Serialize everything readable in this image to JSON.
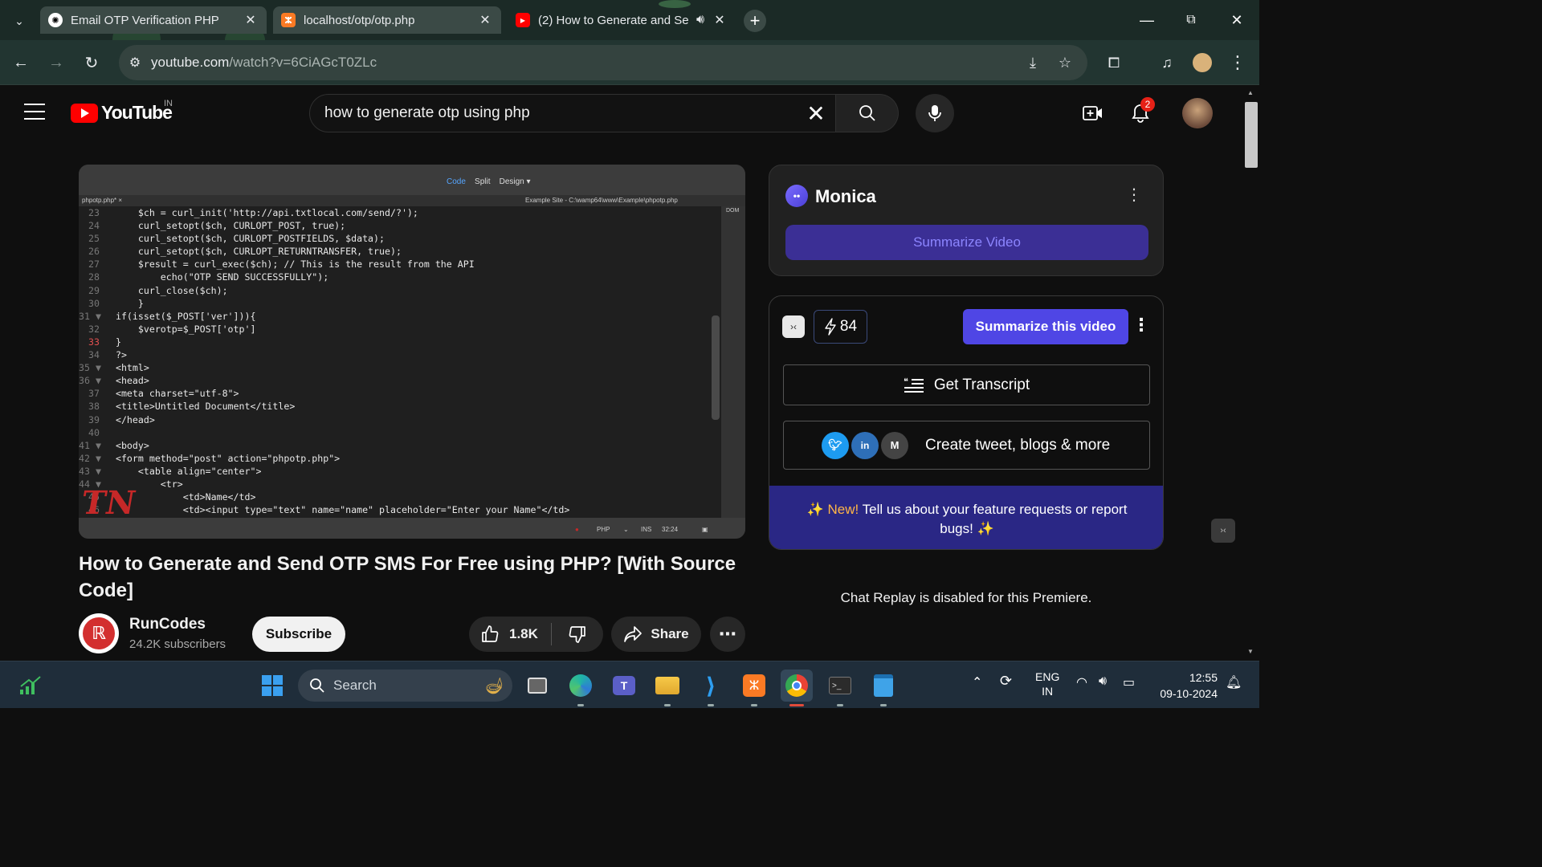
{
  "browser": {
    "tabs": [
      {
        "title": "Email OTP Verification PHP",
        "icon": "chatgpt-icon"
      },
      {
        "title": "localhost/otp/otp.php",
        "icon": "xampp-icon"
      },
      {
        "title": "(2) How to Generate and Se",
        "icon": "youtube-icon"
      }
    ],
    "url_host": "youtube.com",
    "url_path": "/watch?v=6CiAGcT0ZLc"
  },
  "youtube": {
    "logo_text": "YouTube",
    "country": "IN",
    "search_query": "how to generate otp using php",
    "notification_count": "2"
  },
  "editor": {
    "modes": [
      "Code",
      "Split",
      "Design"
    ],
    "file_tab": "phpotp.php* ×",
    "path": "Example Site - C:\\wamp64\\www\\Example\\phpotp.php",
    "side_label": "DOM",
    "status": {
      "lang": "PHP",
      "mode": "INS",
      "pos": "32:24"
    },
    "lines": [
      {
        "n": "23",
        "t": "      $ch = curl_init('http://api.txtlocal.com/send/?');"
      },
      {
        "n": "24",
        "t": "      curl_setopt($ch, CURLOPT_POST, true);"
      },
      {
        "n": "25",
        "t": "      curl_setopt($ch, CURLOPT_POSTFIELDS, $data);"
      },
      {
        "n": "26",
        "t": "      curl_setopt($ch, CURLOPT_RETURNTRANSFER, true);"
      },
      {
        "n": "27",
        "t": "      $result = curl_exec($ch); // This is the result from the API"
      },
      {
        "n": "28",
        "t": "          echo(\"OTP SEND SUCCESSFULLY\");"
      },
      {
        "n": "29",
        "t": "      curl_close($ch);"
      },
      {
        "n": "30",
        "t": "      }"
      },
      {
        "n": "31 ▼",
        "t": "  if(isset($_POST['ver'])){"
      },
      {
        "n": "32",
        "t": "      $verotp=$_POST['otp']"
      },
      {
        "n": "33",
        "t": "  }"
      },
      {
        "n": "34",
        "t": "  ?>"
      },
      {
        "n": "35 ▼",
        "t": "  <html>"
      },
      {
        "n": "36 ▼",
        "t": "  <head>"
      },
      {
        "n": "37",
        "t": "  <meta charset=\"utf-8\">"
      },
      {
        "n": "38",
        "t": "  <title>Untitled Document</title>"
      },
      {
        "n": "39",
        "t": "  </head>"
      },
      {
        "n": "40",
        "t": ""
      },
      {
        "n": "41 ▼",
        "t": "  <body>"
      },
      {
        "n": "42 ▼",
        "t": "  <form method=\"post\" action=\"phpotp.php\">"
      },
      {
        "n": "43 ▼",
        "t": "      <table align=\"center\">"
      },
      {
        "n": "44 ▼",
        "t": "          <tr>"
      },
      {
        "n": "45",
        "t": "              <td>Name</td>"
      },
      {
        "n": "46",
        "t": "              <td><input type=\"text\" name=\"name\" placeholder=\"Enter your Name\"</td>"
      }
    ],
    "watermark": "TN"
  },
  "video": {
    "title": "How to Generate and Send OTP SMS For Free using PHP? [With Source Code]",
    "channel": "RunCodes",
    "subscribers": "24.2K subscribers",
    "subscribe_label": "Subscribe",
    "likes": "1.8K",
    "share_label": "Share"
  },
  "monica": {
    "name": "Monica",
    "summarize_video": "Summarize Video",
    "credits": "84",
    "summarize_this_video": "Summarize this video",
    "get_transcript": "Get Transcript",
    "create_label": "Create tweet, blogs & more",
    "feedback_new": "New!",
    "feedback_text": "Tell us about your feature requests or report bugs!",
    "accent": "#4f46e5"
  },
  "chat_replay": "Chat Replay is disabled for this Premiere.",
  "taskbar": {
    "search_placeholder": "Search",
    "lang_top": "ENG",
    "lang_bottom": "IN",
    "time": "12:55",
    "date": "09-10-2024"
  }
}
